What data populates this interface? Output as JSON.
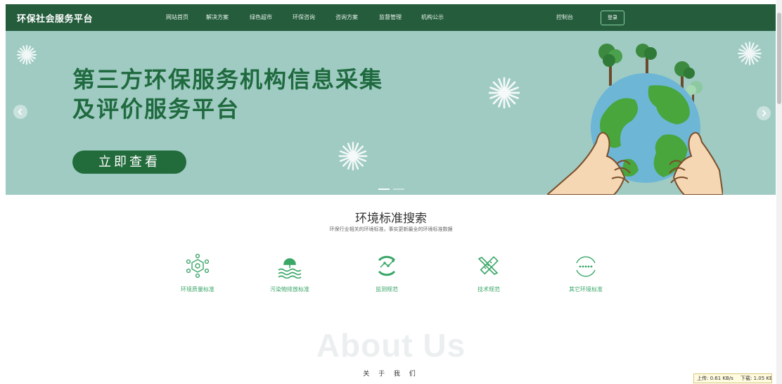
{
  "header": {
    "brand": "环保社会服务平台",
    "nav": [
      "网站首页",
      "解决方案",
      "绿色超市",
      "环保咨询",
      "咨询方案",
      "监督管理",
      "机构公示"
    ],
    "console": "控制台",
    "login": "登录"
  },
  "banner": {
    "title_line1": "第三方环保服务机构信息采集",
    "title_line2": "及评价服务平台",
    "cta": "立即查看",
    "prev_icon": "chevron-left-icon",
    "next_icon": "chevron-right-icon",
    "active_slide": 1,
    "slide_count": 2
  },
  "standards": {
    "title": "环境标准搜索",
    "subtitle": "环保行业相关的环境标准，事实更新最全的环境标准数据",
    "categories": [
      {
        "label": "环境质量标准",
        "icon": "network-cube-icon"
      },
      {
        "label": "污染物排放标准",
        "icon": "water-discharge-icon"
      },
      {
        "label": "监测规范",
        "icon": "monitoring-circle-icon"
      },
      {
        "label": "技术规范",
        "icon": "ruler-pencil-icon"
      },
      {
        "label": "其它环境标准",
        "icon": "more-dots-icon"
      }
    ]
  },
  "about": {
    "heading": "About Us",
    "subheading": "关 于 我 们"
  },
  "netspeed": {
    "upload": "上传: 0.61 KB/s",
    "download": "下载: 1.05 KB"
  },
  "colors": {
    "header_bg": "#245c3c",
    "banner_bg": "#9fcbc3",
    "accent_green": "#3aa668",
    "title_green": "#1f6a3e"
  }
}
